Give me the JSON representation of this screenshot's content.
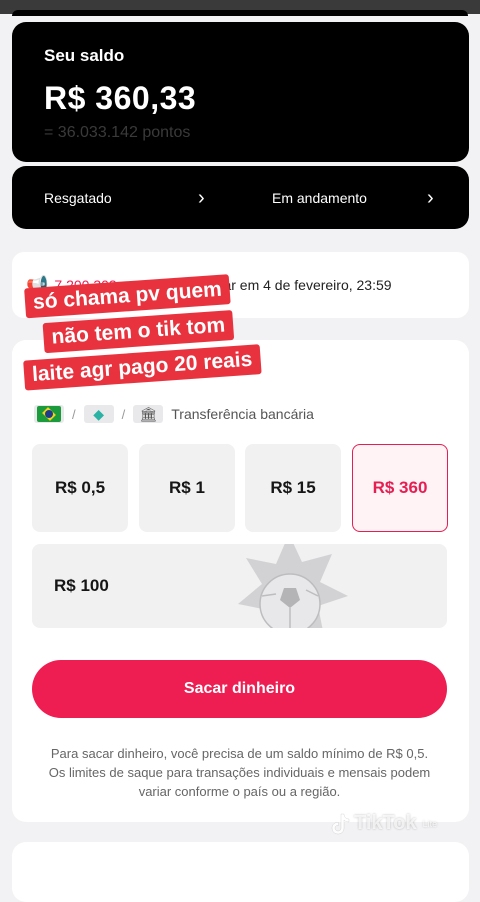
{
  "balance": {
    "label": "Seu saldo",
    "amount": "R$ 360,33",
    "points": "= 36.033.142 pontos"
  },
  "status": {
    "redeemed": "Resgatado",
    "in_progress": "Em andamento"
  },
  "expiry": {
    "points": "7.200.302",
    "text": "pontos vão expirar em 4 de fevereiro, 23:59"
  },
  "methods": {
    "bank_transfer": "Transferência bancária"
  },
  "amounts": [
    "R$ 0,5",
    "R$ 1",
    "R$ 15",
    "R$ 360"
  ],
  "amount_wide": "R$ 100",
  "selected_amount": "R$ 360",
  "withdraw_button": "Sacar dinheiro",
  "note": "Para sacar dinheiro, você precisa de um saldo mínimo de R$ 0,5. Os limites de saque para transações individuais e mensais podem variar conforme o país ou a região.",
  "overlay": {
    "line1": "só chama pv quem",
    "line2": "não tem o tik tom",
    "line3": "laite agr pago 20 reais"
  },
  "watermark": {
    "text": "TikTok",
    "sub": "Lite"
  },
  "colors": {
    "accent": "#ee1d52",
    "card_dark": "#000000",
    "background": "#f2f2f4"
  }
}
